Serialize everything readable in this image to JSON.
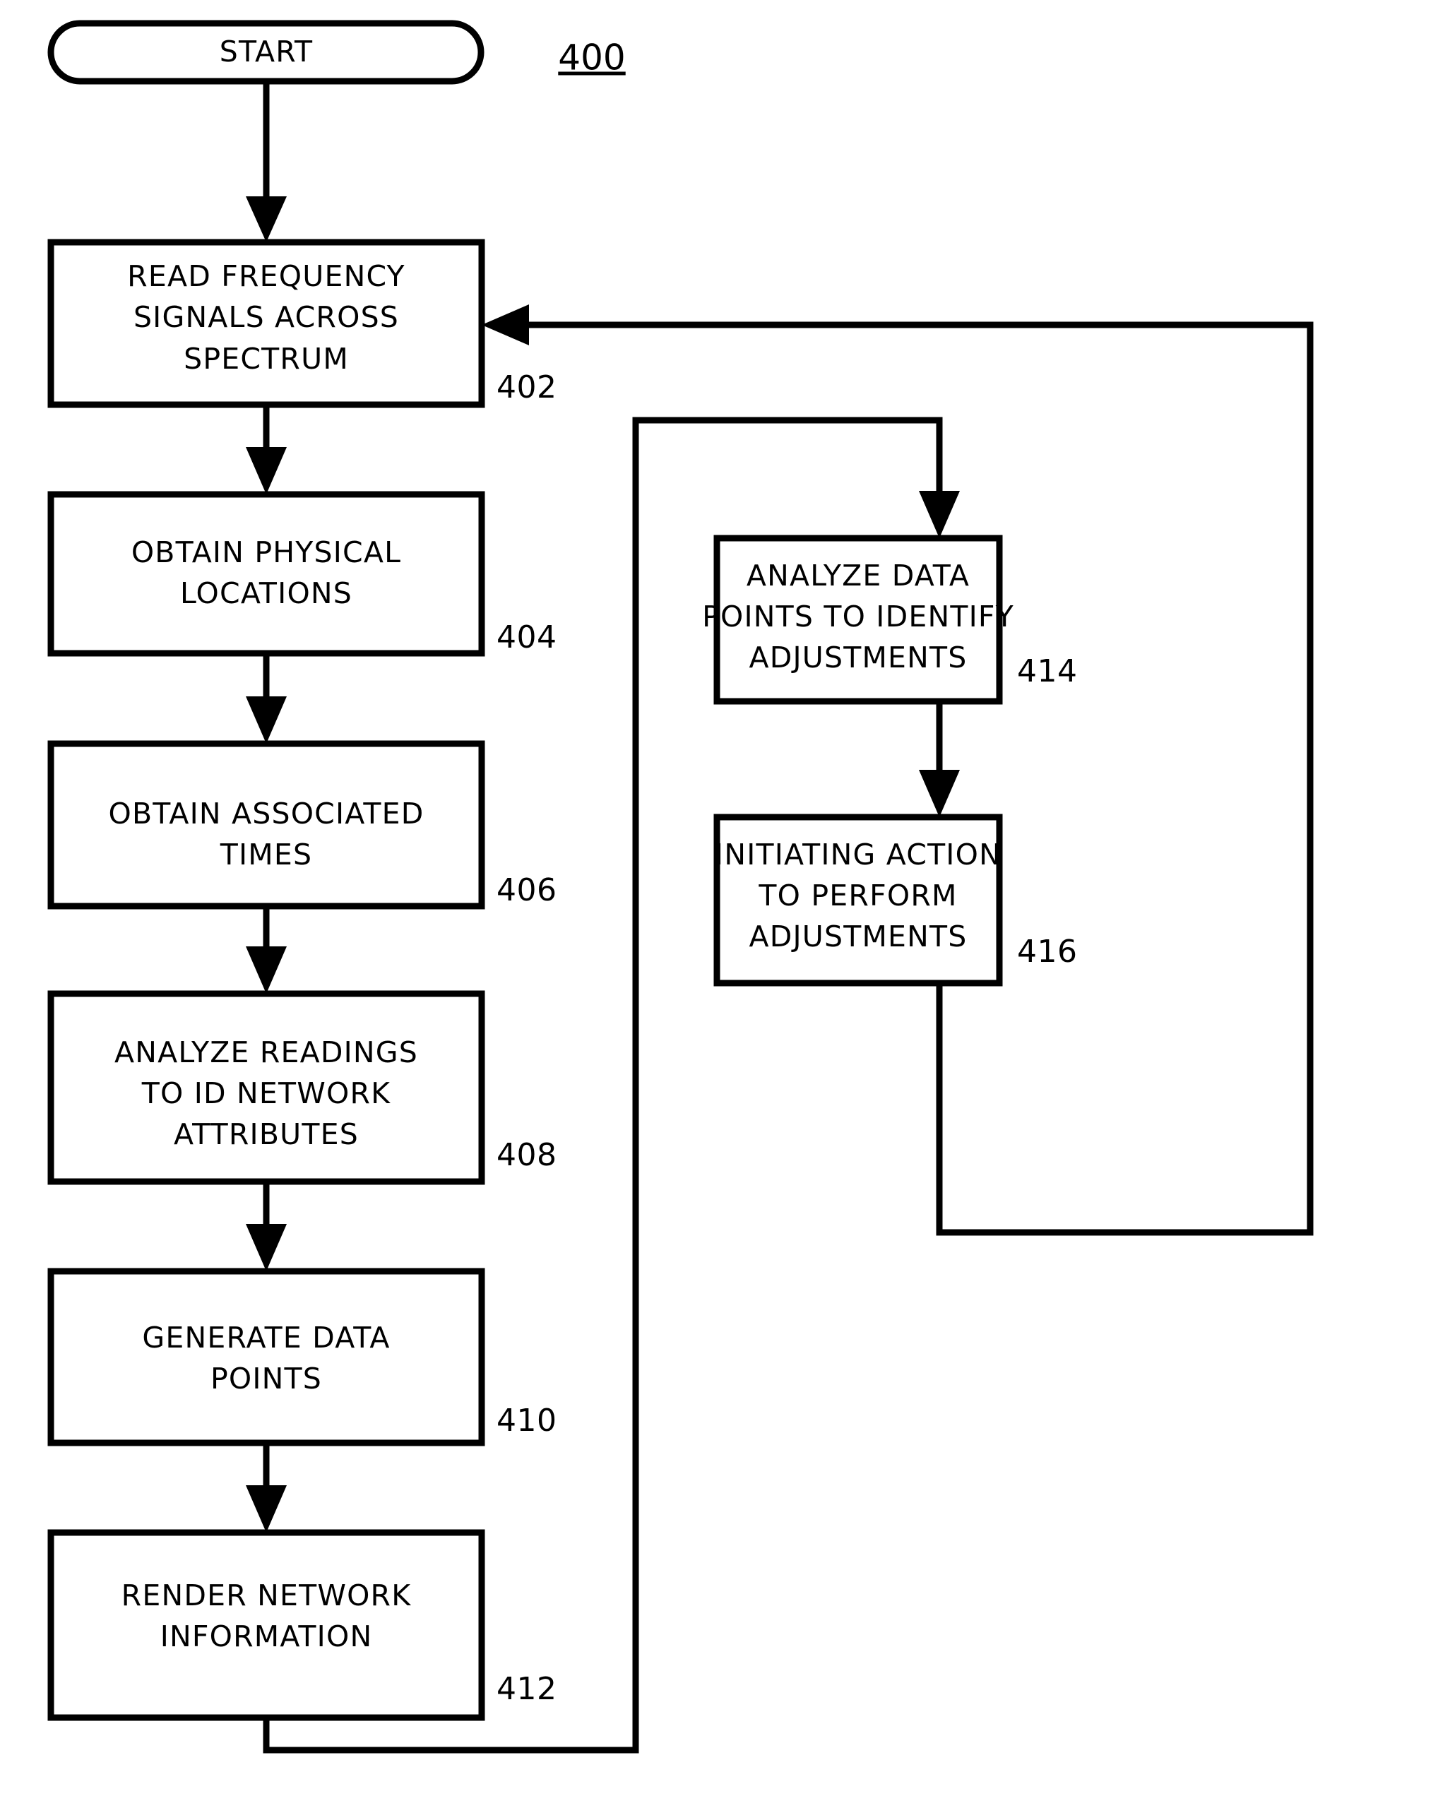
{
  "figure": {
    "number": "400",
    "title_text": "400"
  },
  "nodes": {
    "start": {
      "label": "START",
      "ref": ""
    },
    "n402": {
      "lines": [
        "READ FREQUENCY",
        "SIGNALS ACROSS",
        "SPECTRUM"
      ],
      "ref": "402"
    },
    "n404": {
      "lines": [
        "OBTAIN PHYSICAL",
        "LOCATIONS"
      ],
      "ref": "404"
    },
    "n406": {
      "lines": [
        "OBTAIN ASSOCIATED",
        "TIMES"
      ],
      "ref": "406"
    },
    "n408": {
      "lines": [
        "ANALYZE READINGS",
        "TO ID NETWORK",
        "ATTRIBUTES"
      ],
      "ref": "408"
    },
    "n410": {
      "lines": [
        "GENERATE DATA",
        "POINTS"
      ],
      "ref": "410"
    },
    "n412": {
      "lines": [
        "RENDER  NETWORK",
        "INFORMATION"
      ],
      "ref": "412"
    },
    "n414": {
      "lines": [
        "ANALYZE  DATA",
        "POINTS TO IDENTIFY",
        "ADJUSTMENTS"
      ],
      "ref": "414"
    },
    "n416": {
      "lines": [
        "INITIATING ACTION",
        "TO PERFORM",
        "ADJUSTMENTS"
      ],
      "ref": "416"
    }
  },
  "text": {
    "n402_l0": "READ FREQUENCY",
    "n402_l1": "SIGNALS ACROSS",
    "n402_l2": "SPECTRUM",
    "n404_l0": "OBTAIN PHYSICAL",
    "n404_l1": "LOCATIONS",
    "n406_l0": "OBTAIN ASSOCIATED",
    "n406_l1": "TIMES",
    "n408_l0": "ANALYZE READINGS",
    "n408_l1": "TO ID NETWORK",
    "n408_l2": "ATTRIBUTES",
    "n410_l0": "GENERATE DATA",
    "n410_l1": "POINTS",
    "n412_l0": "RENDER  NETWORK",
    "n412_l1": "INFORMATION",
    "n414_l0": "ANALYZE  DATA",
    "n414_l1": "POINTS TO IDENTIFY",
    "n414_l2": "ADJUSTMENTS",
    "n416_l0": "INITIATING ACTION",
    "n416_l1": "TO PERFORM",
    "n416_l2": "ADJUSTMENTS",
    "start_label": "START",
    "ref_402": "402",
    "ref_404": "404",
    "ref_406": "406",
    "ref_408": "408",
    "ref_410": "410",
    "ref_412": "412",
    "ref_414": "414",
    "ref_416": "416",
    "fig_num": "400"
  },
  "colors": {
    "stroke": "#000000",
    "fill": "#ffffff",
    "background": "#ffffff"
  }
}
